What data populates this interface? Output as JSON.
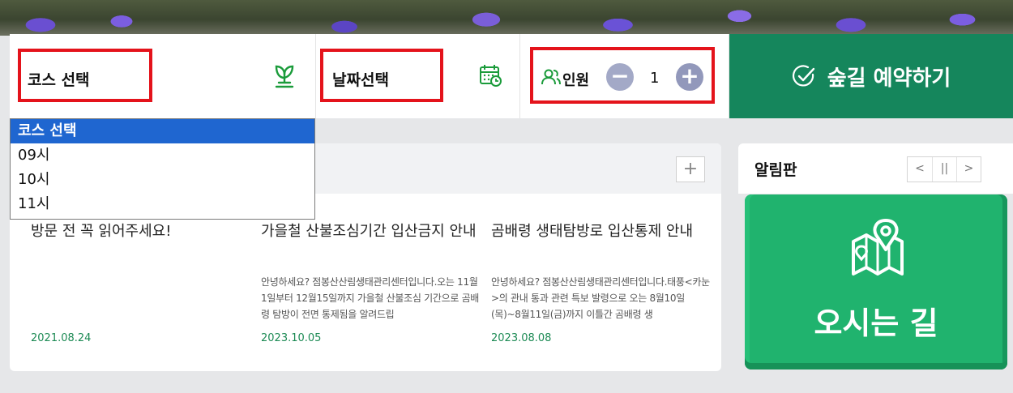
{
  "reservation": {
    "course_label": "코스 선택",
    "date_label": "날짜선택",
    "people_label": "인원",
    "minus_symbol": "−",
    "plus_symbol": "+",
    "people_count": "1",
    "reserve_label": "숲길 예약하기"
  },
  "course_dropdown": {
    "options": [
      "코스 선택",
      "09시",
      "10시",
      "11시"
    ],
    "selected": "코스 선택"
  },
  "news": {
    "more_symbol": "+",
    "articles": [
      {
        "title": "방문 전 꼭 읽어주세요!",
        "body": "",
        "date": "2021.08.24"
      },
      {
        "title": "가을철 산불조심기간 입산금지 안내",
        "body": "안녕하세요? 점봉산산림생태관리센터입니다.오는 11월1일부터 12월15일까지 가을철 산불조심 기간으로 곰배령 탐방이 전면 통제됨을 알려드립",
        "date": "2023.10.05"
      },
      {
        "title": "곰배령 생태탐방로 입산통제 안내",
        "body": "안녕하세요? 점봉산산림생태관리센터입니다.태풍<카눈>의 관내 통과 관련 특보 발령으로 오는 8월10일(목)~8월11일(금)까지 이틀간 곰배령 생",
        "date": "2023.08.08"
      }
    ]
  },
  "notice": {
    "title": "알림판",
    "prev_symbol": "<",
    "pause_symbol": "||",
    "next_symbol": ">"
  },
  "directions": {
    "label": "오시는 길"
  },
  "colors": {
    "accent_green": "#15865c",
    "highlight_red": "#e4131b",
    "select_blue": "#1f66d0",
    "directions_green": "#20b36e"
  }
}
